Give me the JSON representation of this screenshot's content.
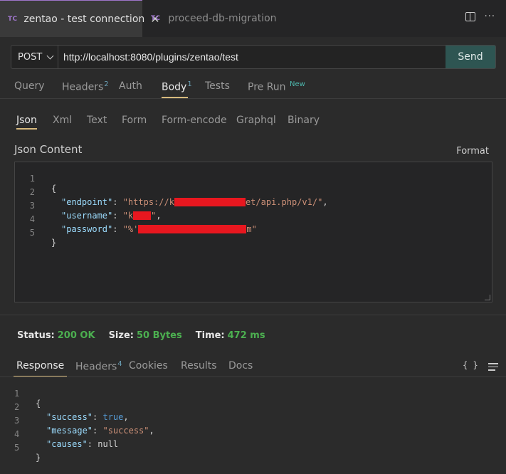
{
  "tabs": [
    {
      "badge": "TC",
      "title": "zentao - test connection",
      "close": "✕"
    },
    {
      "badge": "TC",
      "title": "proceed-db-migration"
    }
  ],
  "tabbar_icons": [
    "split-editor-icon",
    "more-icon"
  ],
  "request": {
    "method": "POST",
    "url": "http://localhost:8080/plugins/zentao/test",
    "send_label": "Send"
  },
  "request_tabs": [
    {
      "label": "Query",
      "count": ""
    },
    {
      "label": "Headers",
      "count": "2"
    },
    {
      "label": "Auth",
      "count": ""
    },
    {
      "label": "Body",
      "count": "1"
    },
    {
      "label": "Tests",
      "count": ""
    },
    {
      "label": "Pre Run",
      "count": "New"
    }
  ],
  "body_tabs": [
    "Json",
    "Xml",
    "Text",
    "Form",
    "Form-encode",
    "Graphql",
    "Binary"
  ],
  "json_content": {
    "heading": "Json Content",
    "format_label": "Format",
    "line_numbers": [
      "1",
      "2",
      "3",
      "4",
      "5"
    ],
    "lines": {
      "open": "{",
      "endpoint_key": "\"endpoint\"",
      "endpoint_val_start": "\"https://k",
      "endpoint_val_end": "et/api.php/v1/\"",
      "username_key": "\"username\"",
      "username_val_start": "\"k",
      "username_val_end": "\"",
      "password_key": "\"password\"",
      "password_val_start": "\"%'",
      "password_val_end": "m\"",
      "close": "}"
    }
  },
  "status": {
    "status_label": "Status:",
    "status_value": "200 OK",
    "size_label": "Size:",
    "size_value": "50 Bytes",
    "time_label": "Time:",
    "time_value": "472 ms"
  },
  "response_tabs": [
    {
      "label": "Response",
      "count": ""
    },
    {
      "label": "Headers",
      "count": "4"
    },
    {
      "label": "Cookies",
      "count": ""
    },
    {
      "label": "Results",
      "count": ""
    },
    {
      "label": "Docs",
      "count": ""
    }
  ],
  "response_icons": {
    "braces": "{ }"
  },
  "response_body": {
    "line_numbers": [
      "1",
      "2",
      "3",
      "4",
      "5"
    ],
    "open": "{",
    "success_key": "\"success\"",
    "success_val": "true",
    "message_key": "\"message\"",
    "message_val": "\"success\"",
    "causes_key": "\"causes\"",
    "causes_val": "null",
    "close": "}"
  },
  "colors": {
    "accent_tab": "#9d75c9",
    "send_button": "#2e5552",
    "active_underline": "#d7ba7d",
    "status_ok": "#4caf50",
    "redaction": "#e8171f"
  }
}
